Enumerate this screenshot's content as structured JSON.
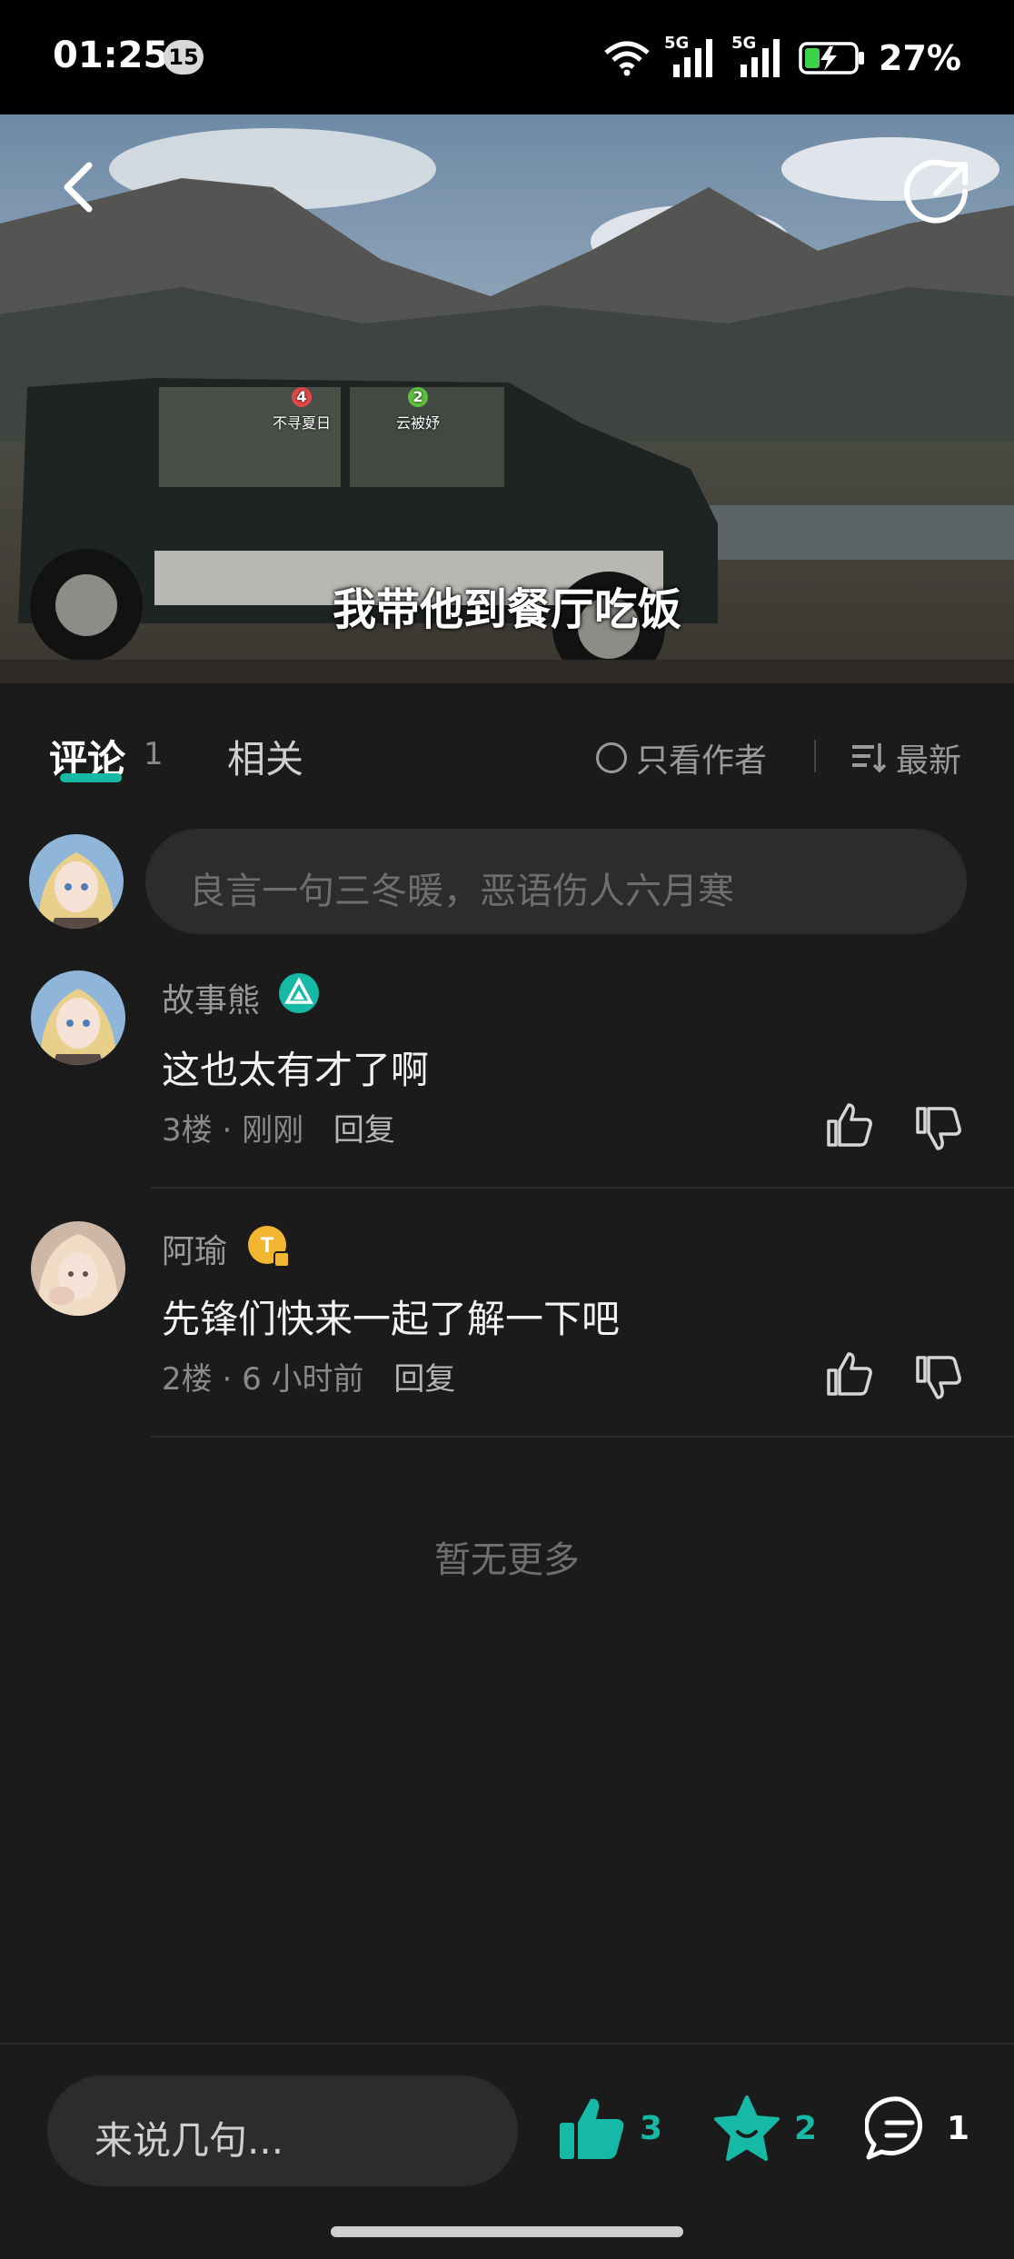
{
  "status_bar": {
    "time": "01:25",
    "notification_count": "15",
    "battery_percent": "27%",
    "signal_labels": [
      "5G",
      "5G"
    ]
  },
  "video": {
    "subtitle": "我带他到餐厅吃饭",
    "player_tags": [
      {
        "number": "4",
        "name": "不寻夏日",
        "color": "#e04848"
      },
      {
        "number": "2",
        "name": "云被妤",
        "color": "#5fbf3f"
      }
    ]
  },
  "tabs": {
    "comments_label": "评论",
    "comments_count": "1",
    "related_label": "相关",
    "author_only_label": "只看作者",
    "sort_label": "最新"
  },
  "comment_input": {
    "placeholder": "良言一句三冬暖，恶语伤人六月寒"
  },
  "comments": [
    {
      "username": "故事熊",
      "text": "这也太有才了啊",
      "floor": "3楼",
      "time": "刚刚",
      "reply_label": "回复"
    },
    {
      "username": "阿瑜",
      "text": "先锋们快来一起了解一下吧",
      "floor": "2楼",
      "time": "6 小时前",
      "reply_label": "回复"
    }
  ],
  "no_more_text": "暂无更多",
  "bottom_bar": {
    "say_placeholder": "来说几句...",
    "like_count": "3",
    "favorite_count": "2",
    "comment_count": "1"
  },
  "colors": {
    "accent": "#16b9a6",
    "background": "#1b1b1b"
  }
}
